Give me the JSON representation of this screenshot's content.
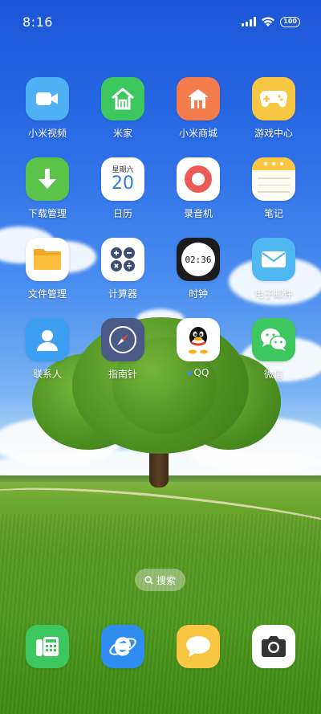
{
  "status_bar": {
    "time": "8:16",
    "battery": "100"
  },
  "apps": [
    {
      "label": "小米视频",
      "icon": "video-camera-icon",
      "color": "#4fb0f5"
    },
    {
      "label": "米家",
      "icon": "mi-home-icon",
      "color": "#3ec65f"
    },
    {
      "label": "小米商城",
      "icon": "mi-store-icon",
      "color": "#f57c4c"
    },
    {
      "label": "游戏中心",
      "icon": "gamepad-icon",
      "color": "#f7c642"
    },
    {
      "label": "下载管理",
      "icon": "download-icon",
      "color": "#5dc24a"
    },
    {
      "label": "日历",
      "icon": "calendar-icon",
      "day_name": "星期六",
      "day_number": "20"
    },
    {
      "label": "录音机",
      "icon": "recorder-icon",
      "color": "#ffffff"
    },
    {
      "label": "笔记",
      "icon": "notes-icon",
      "color": "#fcd45a"
    },
    {
      "label": "文件管理",
      "icon": "folder-icon",
      "color": "#ffffff"
    },
    {
      "label": "计算器",
      "icon": "calculator-icon",
      "color": "#ffffff"
    },
    {
      "label": "时钟",
      "icon": "clock-icon",
      "clock_time": "02:36"
    },
    {
      "label": "电子邮件",
      "icon": "mail-icon",
      "color": "#4fb8f2"
    },
    {
      "label": "联系人",
      "icon": "contacts-icon",
      "color": "#3d9ff2"
    },
    {
      "label": "指南针",
      "icon": "compass-icon",
      "color": "#4a5a86"
    },
    {
      "label": "QQ",
      "icon": "qq-penguin-icon",
      "color": "#ffffff",
      "new_badge": true
    },
    {
      "label": "微信",
      "icon": "wechat-icon",
      "color": "#3ec65f"
    }
  ],
  "search": {
    "label": "搜索"
  },
  "dock": [
    {
      "icon": "phone-icon",
      "color": "#3ec65f"
    },
    {
      "icon": "browser-icon",
      "color": "#2f8cf0"
    },
    {
      "icon": "messages-icon",
      "color": "#f7c642"
    },
    {
      "icon": "camera-icon",
      "color": "#ffffff"
    }
  ]
}
